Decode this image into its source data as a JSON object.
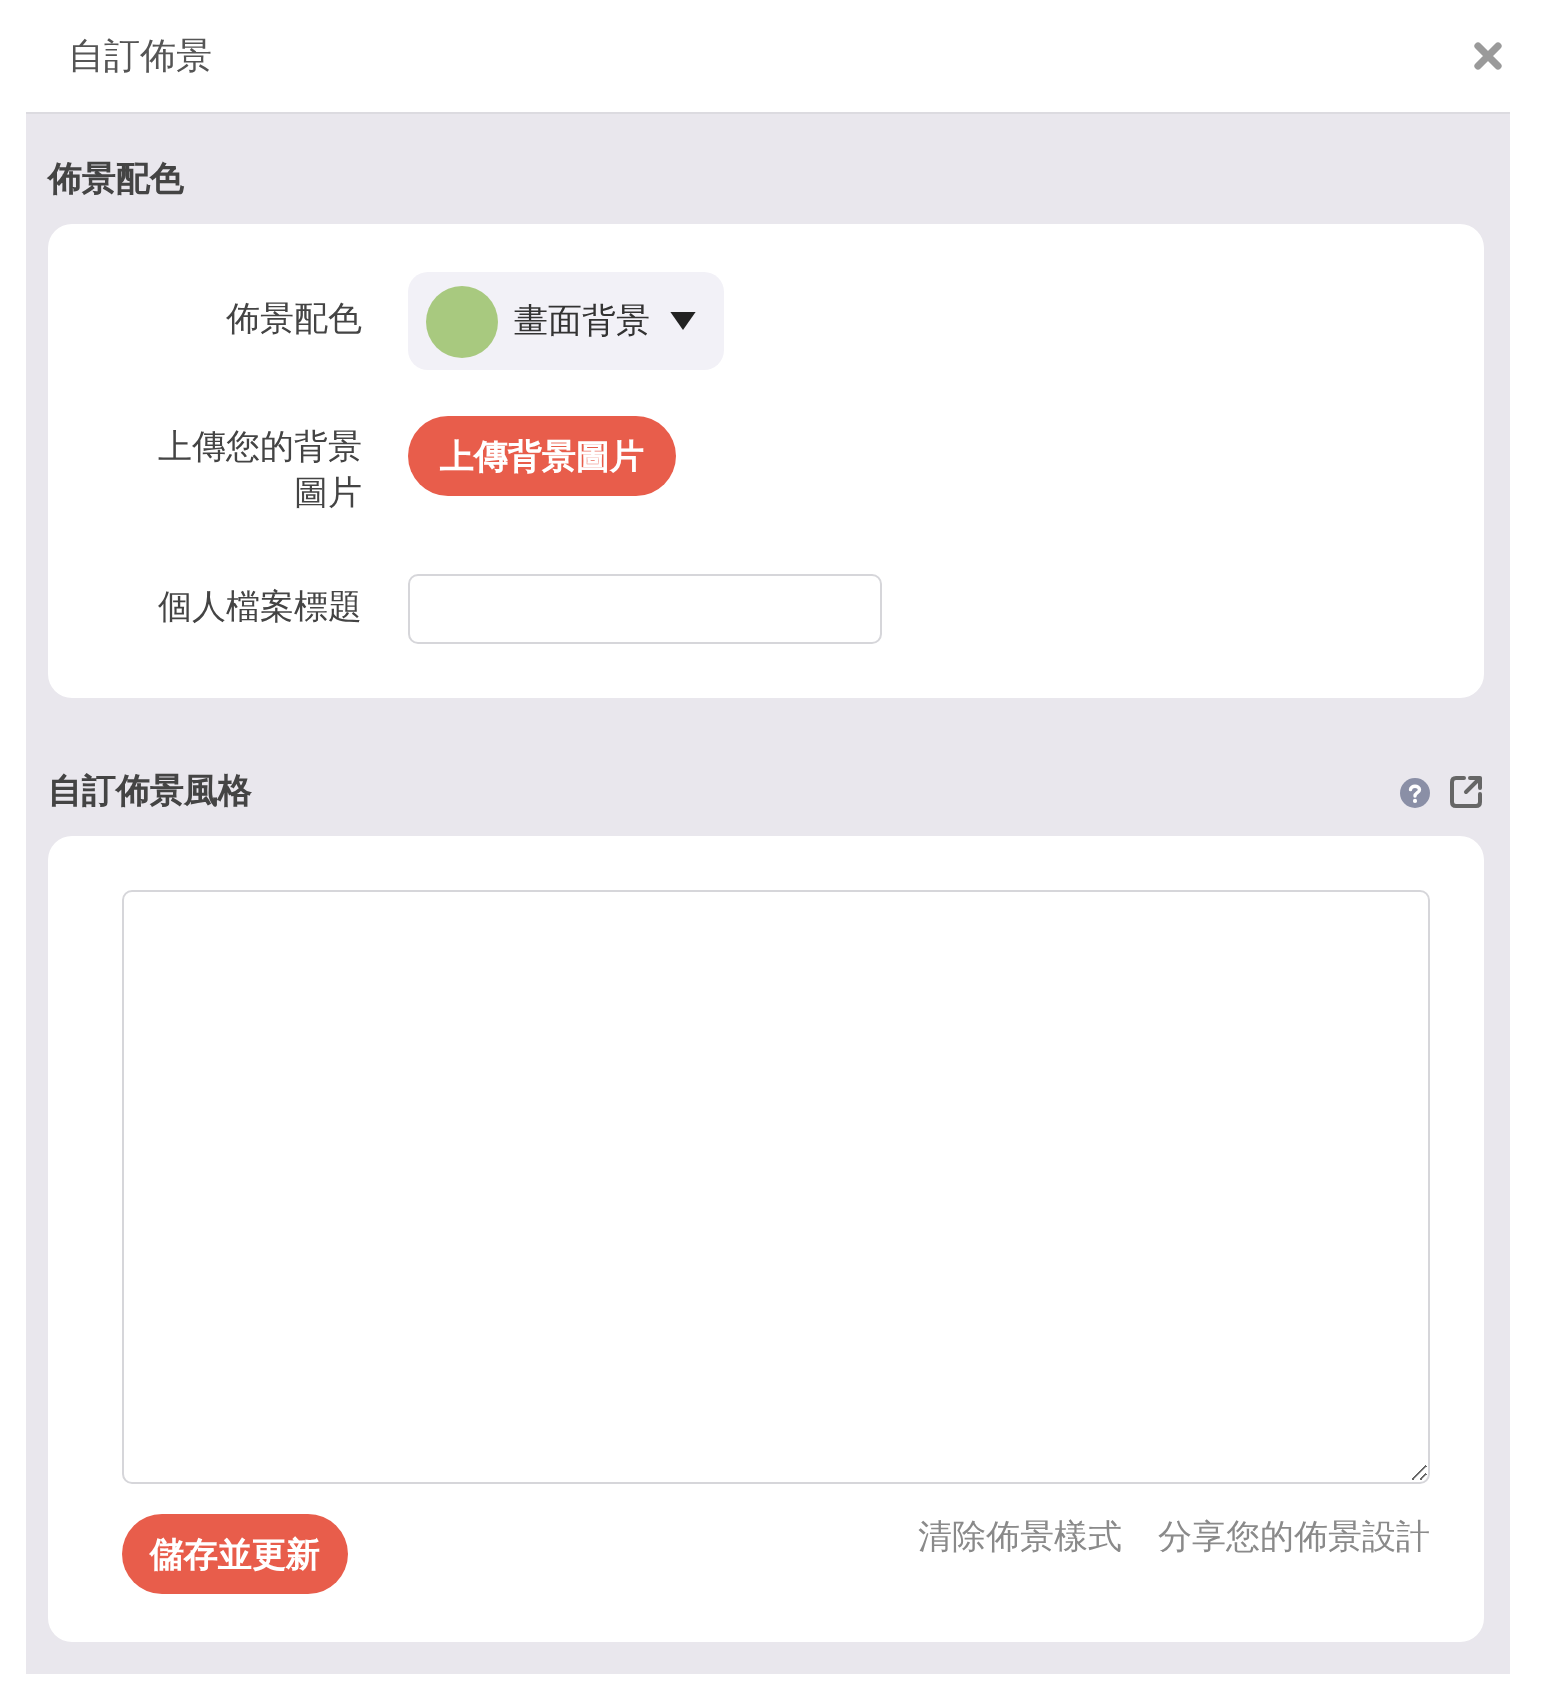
{
  "dialog": {
    "title": "自訂佈景"
  },
  "color_section": {
    "heading": "佈景配色",
    "fields": [
      {
        "kind": "dropdown",
        "label": "佈景配色",
        "value": "畫面背景",
        "color": "#a8c97f"
      },
      {
        "kind": "upload",
        "label": "上傳您的背景圖片",
        "button": "上傳背景圖片"
      },
      {
        "kind": "input",
        "label": "個人檔案標題"
      }
    ]
  },
  "style_section": {
    "heading": "自訂佈景風格",
    "save_button": "儲存並更新",
    "links": [
      "清除佈景樣式",
      "分享您的佈景設計"
    ]
  }
}
